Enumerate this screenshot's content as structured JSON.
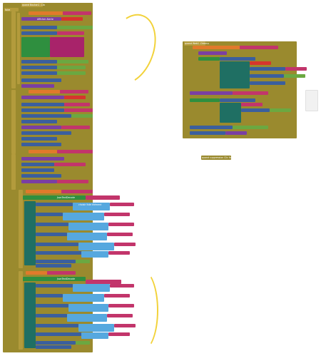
{
  "blocks": {
    "event_top": "quand Bouton1 .Clic",
    "do_label": "faire",
    "if_label": "si",
    "then_label": "alors",
    "else_label": "sinon",
    "set_label": "mettre",
    "call_label": "appeler",
    "choose_block": "choisir liste élément",
    "decode_json": "JsonTextDecode",
    "visible_text": "Visible",
    "to_text": "à",
    "text_block": "Texte",
    "true_text": "vrai",
    "false_text": "faux",
    "item_list": "liste",
    "index_text": "index",
    "show_alert": "Afficher Alerte",
    "right_event": "quand Web1 .Obtenu",
    "small_block": "quand suppression Clic fait"
  },
  "annotations": {
    "highlight_color": "#f2d23a",
    "count": 2
  }
}
